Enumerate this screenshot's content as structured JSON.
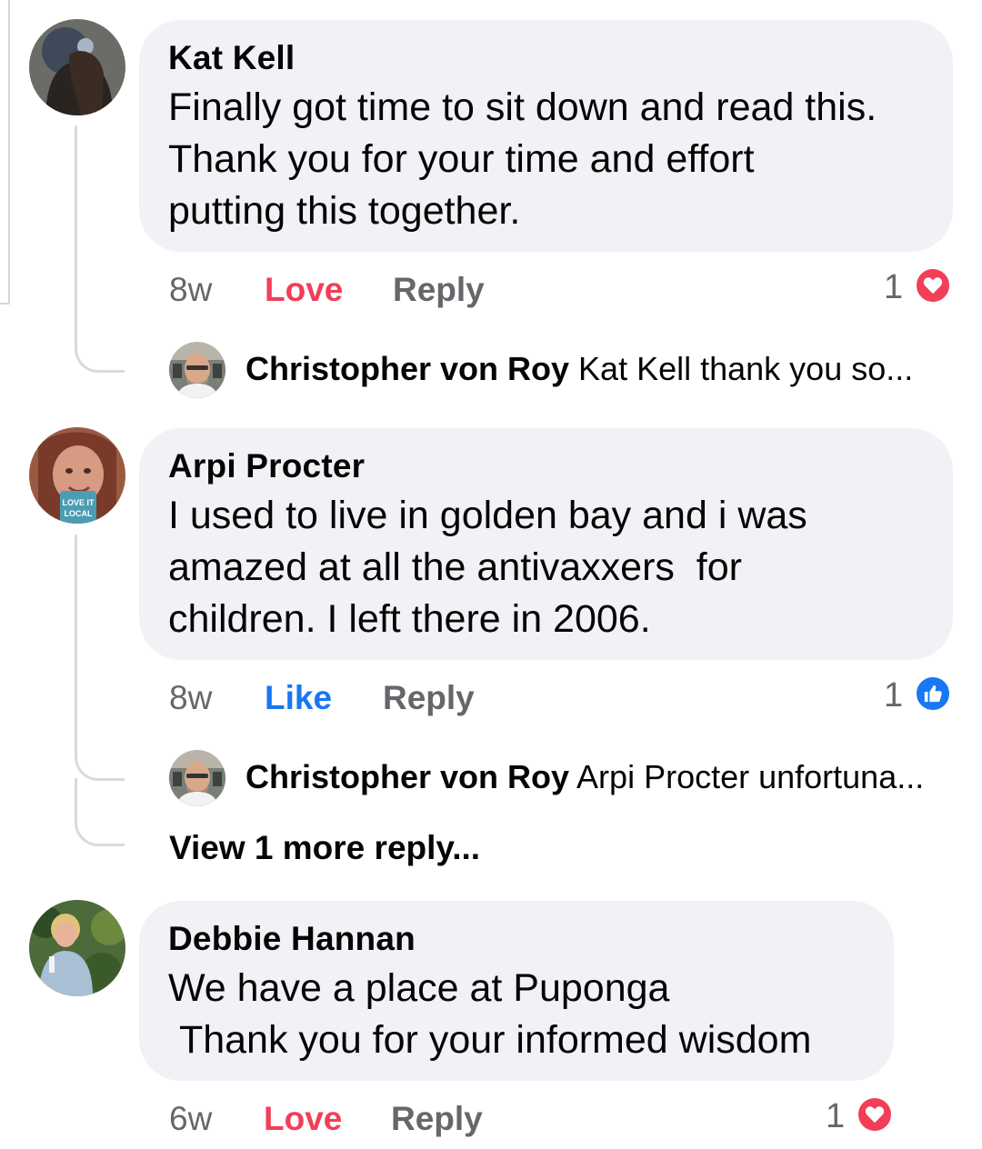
{
  "comments": [
    {
      "author": "Kat Kell",
      "text": "Finally got time to sit down and read this.\nThank you for your time and effort\nputting this together.",
      "time": "8w",
      "reaction_label": "Love",
      "reply_label": "Reply",
      "reaction_count": "1",
      "reaction_icon": "heart-icon",
      "replies": [
        {
          "author": "Christopher von Roy",
          "text": "Kat Kell thank you so..."
        }
      ]
    },
    {
      "author": "Arpi Procter",
      "text": "I used to live in golden bay and i was\namazed at all the antivaxxers  for\nchildren. I left there in 2006.",
      "time": "8w",
      "reaction_label": "Like",
      "reply_label": "Reply",
      "reaction_count": "1",
      "reaction_icon": "thumbs-up-icon",
      "replies": [
        {
          "author": "Christopher von Roy",
          "text": "Arpi Procter unfortuna..."
        }
      ],
      "more_replies": "View 1 more reply...",
      "avatar_badge": "LOVE IT LOCAL"
    },
    {
      "author": "Debbie Hannan",
      "text": "We have a place at Puponga\n Thank you for your informed wisdom",
      "time": "6w",
      "reaction_label": "Love",
      "reply_label": "Reply",
      "reaction_count": "1",
      "reaction_icon": "heart-icon"
    }
  ],
  "colors": {
    "love": "#f33e58",
    "like": "#1877f2",
    "meta": "#65676b",
    "bubble": "#f0f2f5"
  }
}
